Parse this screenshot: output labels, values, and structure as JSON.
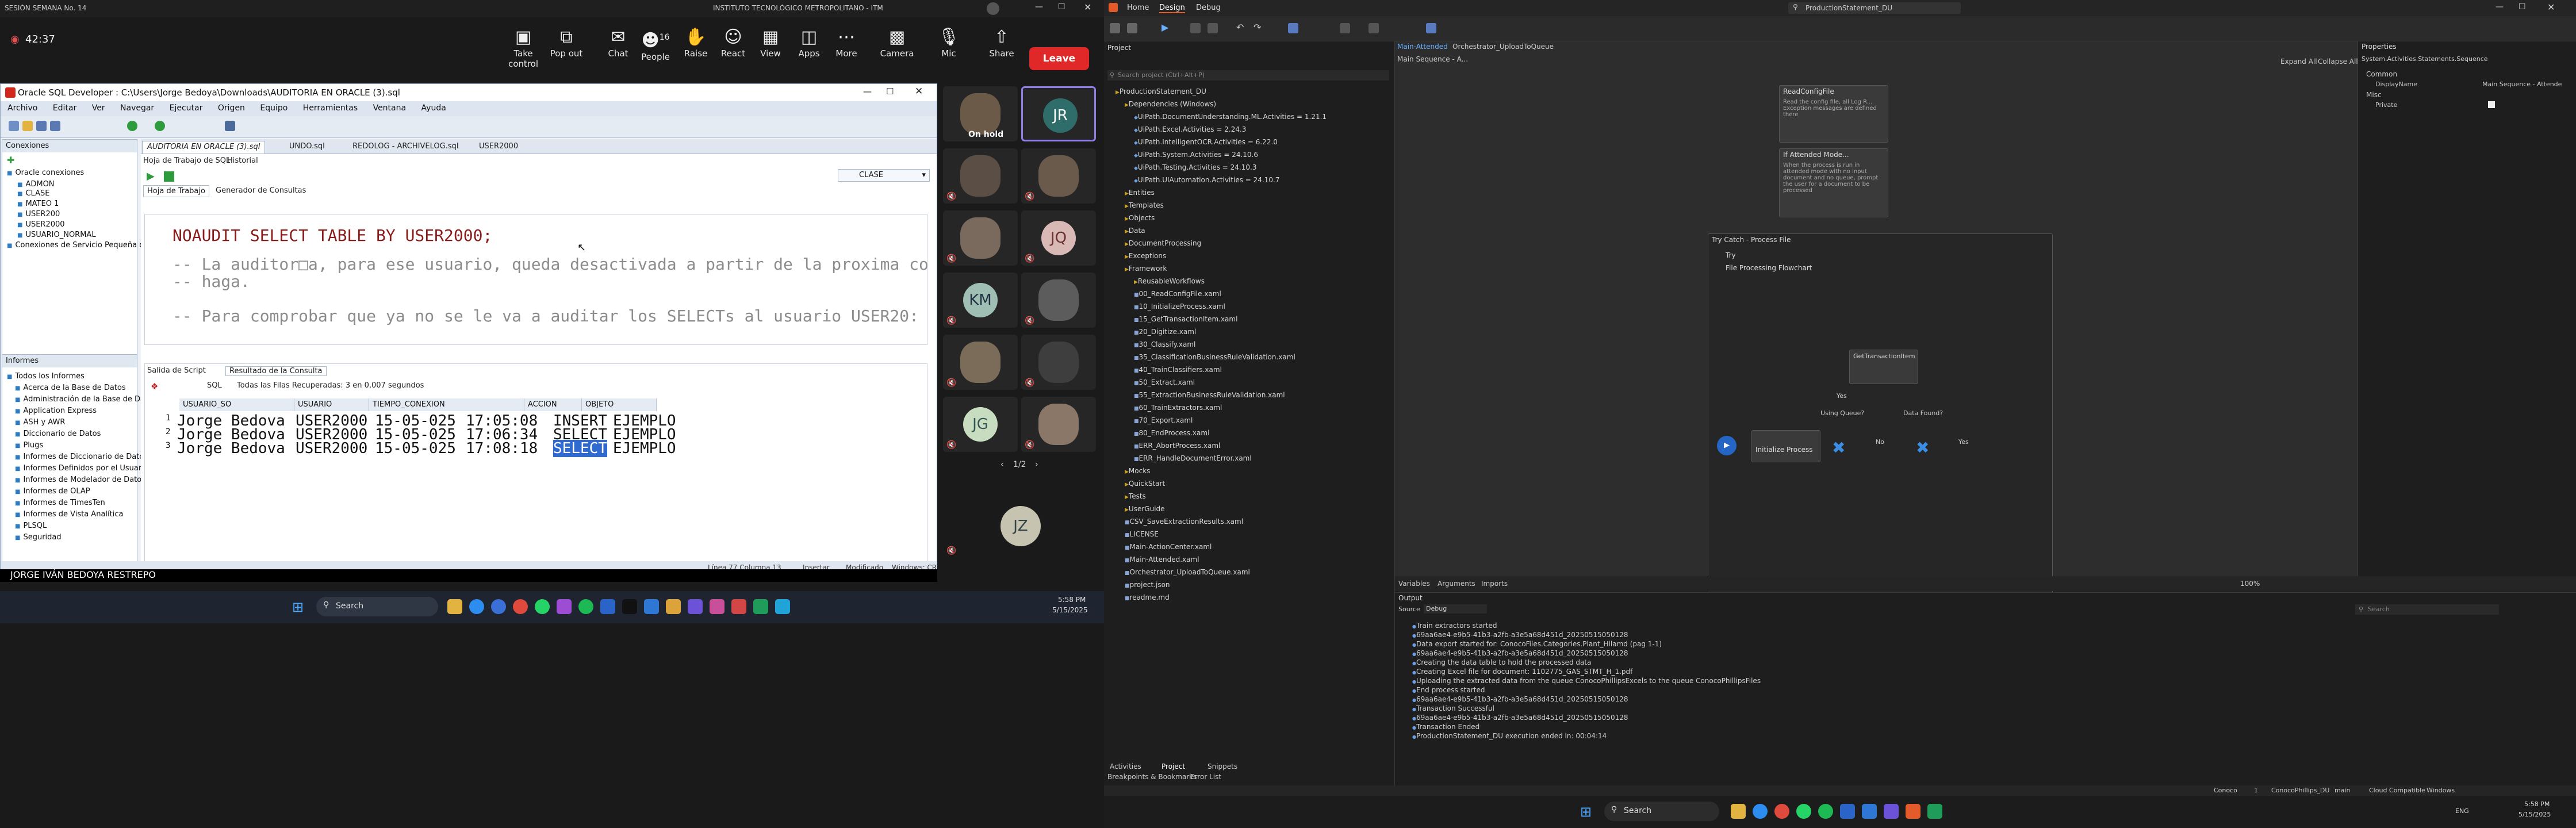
{
  "zoom": {
    "session_title": "SESIÓN SEMANA No. 14",
    "meeting_name": "INSTITUTO TECNOLÓGICO METROPOLITANO - ITM",
    "timer": "42:37",
    "toolbar": [
      {
        "label": "Take control",
        "icon": "take-control-icon"
      },
      {
        "label": "Pop out",
        "icon": "pop-out-icon"
      },
      {
        "label": "Chat",
        "icon": "chat-icon"
      },
      {
        "label": "People",
        "icon": "people-icon",
        "count": "16"
      },
      {
        "label": "Raise",
        "icon": "raise-hand-icon"
      },
      {
        "label": "React",
        "icon": "react-icon"
      },
      {
        "label": "View",
        "icon": "view-icon"
      },
      {
        "label": "Apps",
        "icon": "apps-icon"
      },
      {
        "label": "More",
        "icon": "more-icon"
      },
      {
        "label": "Camera",
        "icon": "camera-icon"
      },
      {
        "label": "Mic",
        "icon": "mic-icon"
      },
      {
        "label": "Share",
        "icon": "share-icon"
      }
    ],
    "leave_label": "Leave",
    "on_hold": "On hold",
    "participants": [
      "JR",
      "JQ",
      "KM",
      "JG",
      "JZ"
    ],
    "page_indicator": "1/2",
    "caption": "JORGE IVÁN BEDOYA RESTREPO",
    "colors": {
      "leave": "#e02828",
      "selected_border": "#8f7ee6"
    }
  },
  "sqldev": {
    "title": "Oracle SQL Developer : C:\\Users\\Jorge Bedoya\\Downloads\\AUDITORIA EN ORACLE (3).sql",
    "menu": [
      "Archivo",
      "Editar",
      "Ver",
      "Navegar",
      "Ejecutar",
      "Origen",
      "Equipo",
      "Herramientas",
      "Ventana",
      "Ayuda"
    ],
    "connections_title": "Conexiones",
    "connections": [
      "Oracle conexiones",
      "ADMON",
      "CLASE",
      "MATEO 1",
      "USER200",
      "USER2000",
      "USUARIO_NORMAL",
      "Conexiones de Servicio Pequeña de Base de Datos"
    ],
    "reports_title": "Informes",
    "reports": [
      "Todos los Informes",
      "Acerca de la Base de Datos",
      "Administración de la Base de Datos",
      "Application Express",
      "ASH y AWR",
      "Diccionario de Datos",
      "Plugs",
      "Informes de Diccionario de Datos",
      "Informes Definidos por el Usuario",
      "Informes de Modelador de Datos",
      "Informes de OLAP",
      "Informes de TimesTen",
      "Informes de Vista Analítica",
      "PLSQL",
      "Seguridad"
    ],
    "file_tabs": [
      "AUDITORIA EN ORACLE (3).sql",
      "UNDO.sql",
      "REDOLOG - ARCHIVELOG.sql",
      "USER2000"
    ],
    "connection_selector": "CLASE",
    "editor_tabs": [
      "Hoja de Trabajo",
      "Generador de Consultas"
    ],
    "worksheet_tabs": [
      "Hoja de Trabajo de SQL",
      "Historial"
    ],
    "code_lines": [
      "NOAUDIT SELECT TABLE  BY USER2000;",
      "-- La auditor□a, para ese usuario, queda desactivada a partir de la proxima co",
      "-- haga.",
      "-- Para comprobar que ya no se le va a auditar los SELECTs al usuario USER20:"
    ],
    "result_tabs": [
      "Salida de Script",
      "Resultado de la Consulta"
    ],
    "result_info": "Todas las Filas Recuperadas: 3 en 0,007 segundos",
    "sql_label": "SQL",
    "columns": [
      "USUARIO_SO",
      "USUARIO",
      "TIEMPO_CONEXION",
      "ACCION",
      "OBJETO"
    ],
    "rows": [
      [
        "1",
        "Jorge Bedova",
        "USER2000",
        "15-05-025",
        "17:05:08",
        "INSERT",
        "EJEMPLO"
      ],
      [
        "2",
        "Jorge Bedova",
        "USER2000",
        "15-05-025",
        "17:06:34",
        "SELECT",
        "EJEMPLO"
      ],
      [
        "3",
        "Jorge Bedova",
        "USER2000",
        "15-05-025",
        "17:08:18",
        "SELECT",
        "EJEMPLO"
      ]
    ],
    "status": [
      "Línea 77 Columna 13",
      "Insertar",
      "Modificado",
      "Windows: CR"
    ]
  },
  "taskbar_left": {
    "search": "Search",
    "time": "5:58 PM",
    "date": "5/15/2025"
  },
  "studio": {
    "title": "ProductionStatement_DU",
    "ribbon_tabs": [
      "Home",
      "Design",
      "Debug"
    ],
    "project_label": "Project",
    "search_placeholder": "Search project (Ctrl+Alt+P)",
    "tree": [
      {
        "text": "ProductionStatement_DU",
        "kind": "fold",
        "indent": 0
      },
      {
        "text": "Dependencies (Windows)",
        "kind": "fold",
        "indent": 1
      },
      {
        "text": "UiPath.DocumentUnderstanding.ML.Activities = 1.21.1",
        "kind": "dep",
        "indent": 2
      },
      {
        "text": "UiPath.Excel.Activities = 2.24.3",
        "kind": "dep",
        "indent": 2
      },
      {
        "text": "UiPath.IntelligentOCR.Activities = 6.22.0",
        "kind": "dep",
        "indent": 2
      },
      {
        "text": "UiPath.System.Activities = 24.10.6",
        "kind": "dep",
        "indent": 2
      },
      {
        "text": "UiPath.Testing.Activities = 24.10.3",
        "kind": "dep",
        "indent": 2
      },
      {
        "text": "UiPath.UIAutomation.Activities = 24.10.7",
        "kind": "dep",
        "indent": 2
      },
      {
        "text": "Entities",
        "kind": "fold",
        "indent": 1
      },
      {
        "text": "Templates",
        "kind": "fold",
        "indent": 1
      },
      {
        "text": "Objects",
        "kind": "fold",
        "indent": 1
      },
      {
        "text": "Data",
        "kind": "fold",
        "indent": 1
      },
      {
        "text": "DocumentProcessing",
        "kind": "fold",
        "indent": 1
      },
      {
        "text": "Exceptions",
        "kind": "fold",
        "indent": 1
      },
      {
        "text": "Framework",
        "kind": "fold",
        "indent": 1
      },
      {
        "text": "ReusableWorkflows",
        "kind": "fold",
        "indent": 2
      },
      {
        "text": "00_ReadConfigFile.xaml",
        "kind": "xaml",
        "indent": 2
      },
      {
        "text": "10_InitializeProcess.xaml",
        "kind": "xaml",
        "indent": 2
      },
      {
        "text": "15_GetTransactionItem.xaml",
        "kind": "xaml",
        "indent": 2
      },
      {
        "text": "20_Digitize.xaml",
        "kind": "xaml",
        "indent": 2
      },
      {
        "text": "30_Classify.xaml",
        "kind": "xaml",
        "indent": 2
      },
      {
        "text": "35_ClassificationBusinessRuleValidation.xaml",
        "kind": "xaml",
        "indent": 2
      },
      {
        "text": "40_TrainClassifiers.xaml",
        "kind": "xaml",
        "indent": 2
      },
      {
        "text": "50_Extract.xaml",
        "kind": "xaml",
        "indent": 2
      },
      {
        "text": "55_ExtractionBusinessRuleValidation.xaml",
        "kind": "xaml",
        "indent": 2
      },
      {
        "text": "60_TrainExtractors.xaml",
        "kind": "xaml",
        "indent": 2
      },
      {
        "text": "70_Export.xaml",
        "kind": "xaml",
        "indent": 2
      },
      {
        "text": "80_EndProcess.xaml",
        "kind": "xaml",
        "indent": 2
      },
      {
        "text": "ERR_AbortProcess.xaml",
        "kind": "xaml",
        "indent": 2
      },
      {
        "text": "ERR_HandleDocumentError.xaml",
        "kind": "xaml",
        "indent": 2
      },
      {
        "text": "Mocks",
        "kind": "fold",
        "indent": 1
      },
      {
        "text": "QuickStart",
        "kind": "fold",
        "indent": 1
      },
      {
        "text": "Tests",
        "kind": "fold",
        "indent": 1
      },
      {
        "text": "UserGuide",
        "kind": "fold",
        "indent": 1
      },
      {
        "text": "CSV_SaveExtractionResults.xaml",
        "kind": "xaml",
        "indent": 1
      },
      {
        "text": "LICENSE",
        "kind": "xaml",
        "indent": 1
      },
      {
        "text": "Main-ActionCenter.xaml",
        "kind": "xaml",
        "indent": 1
      },
      {
        "text": "Main-Attended.xaml",
        "kind": "xaml",
        "indent": 1
      },
      {
        "text": "Orchestrator_UploadToQueue.xaml",
        "kind": "xaml",
        "indent": 1
      },
      {
        "text": "project.json",
        "kind": "xaml",
        "indent": 1
      },
      {
        "text": "readme.md",
        "kind": "xaml",
        "indent": 1
      }
    ],
    "designer_tabs": [
      "Main-Attended",
      "Orchestrator_UploadToQueue"
    ],
    "breadcrumb": "Main Sequence - A...",
    "expand_all": "Expand All",
    "collapse_all": "Collapse All",
    "nodes": {
      "read_config": "ReadConfigFile",
      "read_config_desc": "Read the config file, all Log R... Exception messages are defined there",
      "attended": "If Attended Mode...",
      "attended_desc": "When the process is run in attended mode with no input document and no queue, prompt the user for a document to be processed",
      "try_catch": "Try Catch - Process File",
      "try": "Try",
      "flowchart": "File Processing Flowchart",
      "init": "Initialize Process",
      "get_tx": "GetTransactionItem",
      "using_queue": "Using Queue?",
      "data_found": "Data Found?",
      "yes": "Yes",
      "no": "No"
    },
    "panel_tabs": [
      "Variables",
      "Arguments",
      "Imports"
    ],
    "zoom": "100%",
    "properties_title": "Properties",
    "properties_subtitle": "System.Activities.Statements.Sequence",
    "props": {
      "common": "Common",
      "display_name_label": "DisplayName",
      "display_name_value": "Main Sequence - Attende",
      "misc": "Misc",
      "private_label": "Private"
    },
    "output_title": "Output",
    "output_source_label": "Source",
    "output_source": "Debug",
    "output_search": "Search",
    "output_lines": [
      "Train extractors started",
      "69aa6ae4-e9b5-41b3-a2fb-a3e5a68d451d_20250515050128",
      "Data export started for: ConocoFiles.Categories.Plant_Hilamd (pag 1-1)",
      "69aa6ae4-e9b5-41b3-a2fb-a3e5a68d451d_20250515050128",
      "Creating the data table to hold the processed data",
      "Creating Excel file for document: 1102775_GAS_STMT_H_1.pdf",
      "Uploading the extracted data from the queue ConocoPhillipsExcels to the queue ConocoPhillipsFiles",
      "End process started",
      "69aa6ae4-e9b5-41b3-a2fb-a3e5a68d451d_20250515050128",
      "Transaction Successful",
      "69aa6ae4-e9b5-41b3-a2fb-a3e5a68d451d_20250515050128",
      "Transaction Ended",
      "ProductionStatement_DU execution ended in: 00:04:14"
    ],
    "bottom_tabs": [
      "Activities",
      "Project",
      "Snippets"
    ],
    "bottom_tabs2": [
      "Breakpoints & Bookmarks",
      "Error List"
    ],
    "status": [
      "Conoco",
      "1",
      "ConocoPhillips_DU",
      "main",
      "Cloud Compatible",
      "Windows"
    ]
  },
  "taskbar_right": {
    "search": "Search",
    "time": "5:58 PM",
    "date": "5/15/2025",
    "lang": "ENG"
  }
}
